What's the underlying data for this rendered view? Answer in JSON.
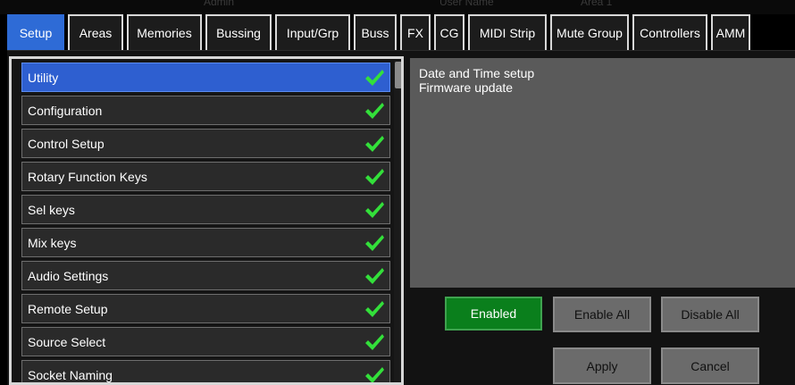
{
  "faint_background": [
    "Admin",
    "User Name",
    "Area 1"
  ],
  "tabs": [
    {
      "label": "Setup",
      "active": true
    },
    {
      "label": "Areas"
    },
    {
      "label": "Memories"
    },
    {
      "label": "Bussing"
    },
    {
      "label": "Input/Grp"
    },
    {
      "label": "Buss"
    },
    {
      "label": "FX"
    },
    {
      "label": "CG"
    },
    {
      "label": "MIDI Strip"
    },
    {
      "label": "Mute Group"
    },
    {
      "label": "Controllers"
    },
    {
      "label": "AMM"
    }
  ],
  "list": {
    "items": [
      {
        "label": "Utility",
        "selected": true,
        "checked": true
      },
      {
        "label": "Configuration",
        "checked": true
      },
      {
        "label": "Control Setup",
        "checked": true
      },
      {
        "label": "Rotary Function Keys",
        "checked": true
      },
      {
        "label": "Sel keys",
        "checked": true
      },
      {
        "label": "Mix keys",
        "checked": true
      },
      {
        "label": "Audio Settings",
        "checked": true
      },
      {
        "label": "Remote Setup",
        "checked": true
      },
      {
        "label": "Source Select",
        "checked": true
      },
      {
        "label": "Socket Naming",
        "checked": true
      }
    ]
  },
  "description": {
    "lines": [
      "Date and Time setup",
      "Firmware update"
    ]
  },
  "buttons": {
    "enabled": "Enabled",
    "enable_all": "Enable All",
    "disable_all": "Disable All",
    "apply": "Apply",
    "cancel": "Cancel"
  },
  "colors": {
    "accent": "#2e6bd6",
    "enabled_green": "#0a7f1c",
    "check_green": "#33e03a"
  }
}
